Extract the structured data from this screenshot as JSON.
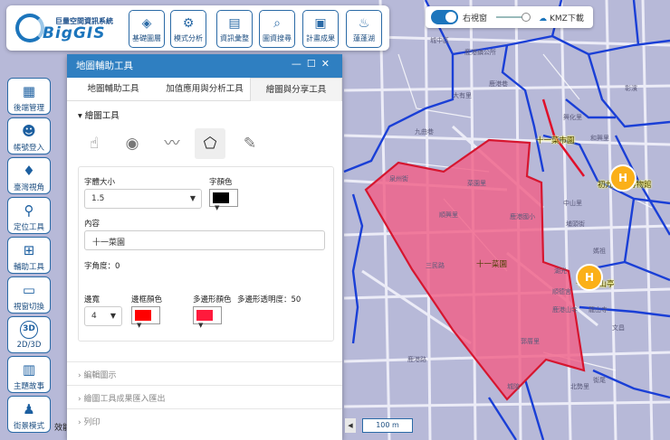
{
  "app": {
    "title_cn": "巨量空間資訊系統",
    "logo_text": "BigGIS"
  },
  "toolbar": {
    "items": [
      {
        "label": "基礎圖層",
        "icon": "layers-icon"
      },
      {
        "label": "模式分析",
        "icon": "model-analysis-icon"
      },
      {
        "label": "資訊彙整",
        "icon": "info-summary-icon"
      },
      {
        "label": "圖資搜尋",
        "icon": "map-search-icon"
      },
      {
        "label": "計畫成果",
        "icon": "plan-results-icon"
      },
      {
        "label": "蓮蓬湖",
        "icon": "lotus-lake-icon"
      }
    ]
  },
  "right_bar": {
    "right_view_label": "右視窗",
    "right_view_on": true,
    "kmz_label": "KMZ下載"
  },
  "sidebar": {
    "items": [
      {
        "label": "後端管理",
        "icon": "grid-icon"
      },
      {
        "label": "帳號登入",
        "icon": "user-icon"
      },
      {
        "label": "臺灣視角",
        "icon": "taiwan-icon"
      },
      {
        "label": "定位工具",
        "icon": "pin-icon"
      },
      {
        "label": "輔助工具",
        "icon": "map-tool-icon"
      },
      {
        "label": "視窗切換",
        "icon": "window-icon"
      },
      {
        "label": "2D/3D",
        "icon": "3d-icon",
        "badge": "3D"
      },
      {
        "label": "主題故事",
        "icon": "book-icon"
      },
      {
        "label": "街景模式",
        "icon": "streetview-icon"
      }
    ],
    "edge_text": "效能"
  },
  "panel": {
    "title": "地圖輔助工具",
    "tabs": [
      {
        "label": "地圖輔助工具",
        "active": false
      },
      {
        "label": "加值應用與分析工具",
        "active": false
      },
      {
        "label": "繪圖與分享工具",
        "active": true
      }
    ],
    "section_title": "繪圖工具",
    "tools": [
      "hand-icon",
      "point-icon",
      "polyline-icon",
      "polygon-icon",
      "ruler-icon"
    ],
    "selected_tool": "polygon-icon",
    "form": {
      "font_size_label": "字體大小",
      "font_size_value": "1.5",
      "font_color_label": "字顏色",
      "font_color": "#000000",
      "content_label": "內容",
      "content_value": "十一菜園",
      "angle_label": "字角度：0",
      "width_label": "邊寬",
      "width_value": "4",
      "border_color_label": "邊框顏色",
      "border_color": "#ff0000",
      "fill_color_label": "多邊形顏色",
      "fill_color": "#ff1a3c",
      "opacity_label": "多邊形透明度：50"
    },
    "accordions": [
      "編輯圖示",
      "繪圖工具成果匯入匯出",
      "列印"
    ]
  },
  "scale_bar": {
    "label": "100 m"
  },
  "map": {
    "polygon_label": "十一菜園",
    "poi": [
      {
        "label": "十一菜市園"
      },
      {
        "label": "初九貫花博物館"
      },
      {
        "label": "十一篁山亭"
      }
    ],
    "labels": [
      "城中區",
      "鹿港鎮公所",
      "鹿港",
      "大有里",
      "鹿港巷",
      "興化里",
      "九曲巷",
      "中山里",
      "埔頭街",
      "龍山里",
      "鹿港國小",
      "菜園里",
      "順興里",
      "鹿港山寺",
      "龍山寺",
      "順德宮",
      "湖光",
      "和興里",
      "文昌",
      "鹿港路",
      "彰濱",
      "媽祖",
      "城隍",
      "街尾",
      "北勢里",
      "郭厝里",
      "泉州街"
    ],
    "colors": {
      "background": "#b7b9d8",
      "roads_major": "#1a3fd6",
      "roads_minor": "#e9e9f6",
      "polygon_fill": "#f06087",
      "polygon_stroke": "#d6162f"
    }
  }
}
